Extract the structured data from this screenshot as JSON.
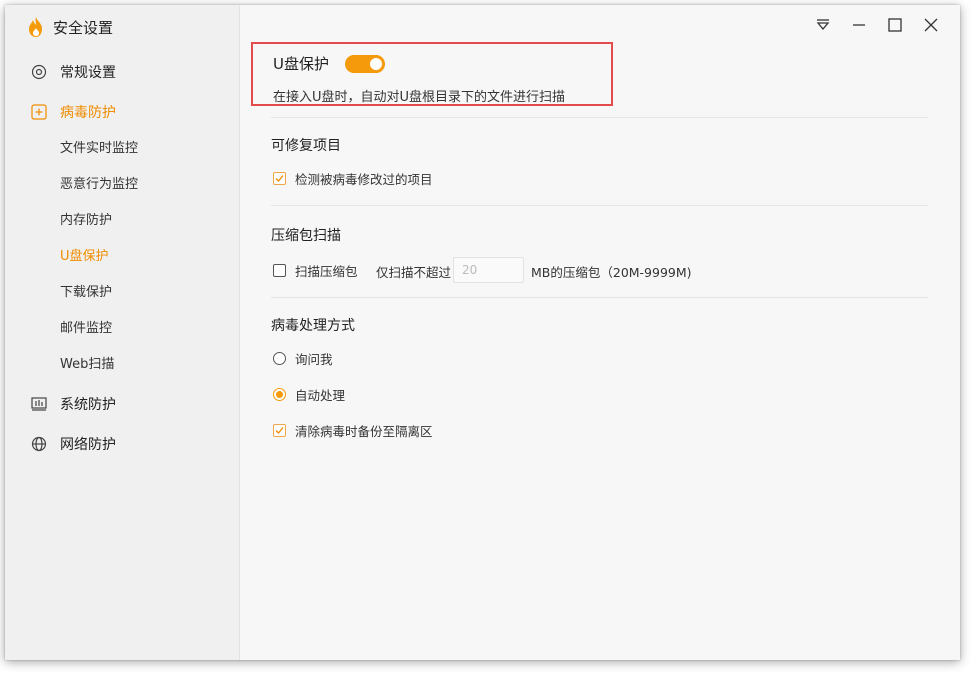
{
  "app": {
    "title": "安全设置"
  },
  "sidebar": {
    "items": [
      {
        "label": "常规设置",
        "icon": "gear-icon"
      },
      {
        "label": "病毒防护",
        "icon": "plus-box-icon"
      },
      {
        "label": "系统防护",
        "icon": "system-monitor-icon"
      },
      {
        "label": "网络防护",
        "icon": "globe-icon"
      }
    ],
    "subitems": [
      "文件实时监控",
      "恶意行为监控",
      "内存防护",
      "U盘保护",
      "下载保护",
      "邮件监控",
      "Web扫描"
    ],
    "active_sub": "U盘保护"
  },
  "titlebar": {
    "icons": [
      "menu-dropdown-icon",
      "minimize-icon",
      "maximize-icon",
      "close-icon"
    ]
  },
  "usb": {
    "title": "U盘保护",
    "enabled": true,
    "description": "在接入U盘时，自动对U盘根目录下的文件进行扫描"
  },
  "repair": {
    "title": "可修复项目",
    "option_label": "检测被病毒修改过的项目",
    "checked": true
  },
  "archive": {
    "title": "压缩包扫描",
    "option_label": "扫描压缩包",
    "checked": false,
    "prefix": "仅扫描不超过",
    "value": "20",
    "suffix": "MB的压缩包（20M-9999M)"
  },
  "handling": {
    "title": "病毒处理方式",
    "options": [
      {
        "label": "询问我",
        "selected": false
      },
      {
        "label": "自动处理",
        "selected": true
      }
    ],
    "backup_label": "清除病毒时备份至隔离区",
    "backup_checked": true
  },
  "colors": {
    "accent": "#f59a0a",
    "highlight": "#e24b4b"
  }
}
